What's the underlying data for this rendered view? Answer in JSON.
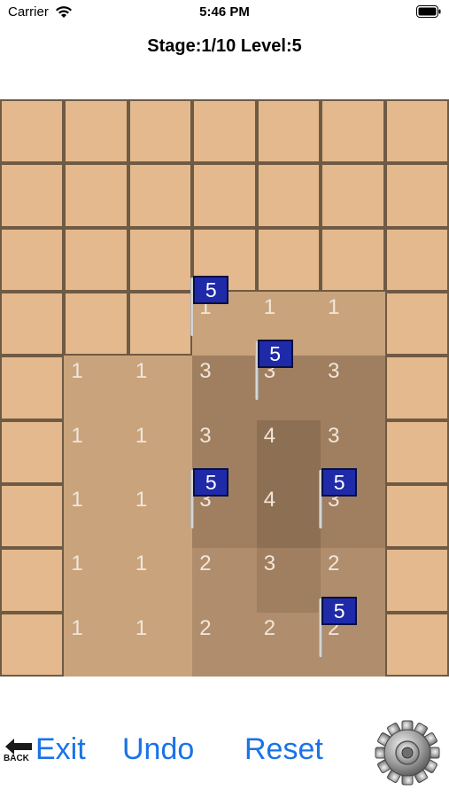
{
  "status": {
    "carrier": "Carrier",
    "time": "5:46 PM"
  },
  "header": {
    "title": "Stage:1/10 Level:5"
  },
  "board": {
    "cols": 7,
    "rows": 9,
    "cells": [
      [
        "raised",
        "raised",
        "raised",
        "raised",
        "raised",
        "raised",
        "raised"
      ],
      [
        "raised",
        "raised",
        "raised",
        "raised",
        "raised",
        "raised",
        "raised"
      ],
      [
        "raised",
        "raised",
        "raised",
        "raised",
        "raised",
        "raised",
        "raised"
      ],
      [
        "raised",
        "raised",
        "raised",
        "1",
        "1",
        "1",
        "raised"
      ],
      [
        "raised",
        "1",
        "1",
        "3",
        "3",
        "3",
        "raised"
      ],
      [
        "raised",
        "1",
        "1",
        "3",
        "4",
        "3",
        "raised"
      ],
      [
        "raised",
        "1",
        "1",
        "3",
        "4",
        "3",
        "raised"
      ],
      [
        "raised",
        "1",
        "1",
        "2",
        "3",
        "2",
        "raised"
      ],
      [
        "raised",
        "1",
        "1",
        "2",
        "2",
        "2",
        "raised"
      ]
    ],
    "flags": [
      {
        "row": 2,
        "col": 2,
        "label": "5"
      },
      {
        "row": 3,
        "col": 3,
        "label": "5"
      },
      {
        "row": 5,
        "col": 2,
        "label": "5"
      },
      {
        "row": 5,
        "col": 4,
        "label": "5"
      },
      {
        "row": 7,
        "col": 4,
        "label": "5"
      }
    ]
  },
  "controls": {
    "back_text": "BACK",
    "exit_label": "Exit",
    "undo_label": "Undo",
    "reset_label": "Reset"
  },
  "colors": {
    "raised": "#e3b98d",
    "level1": "#c9a37c",
    "level2": "#b08d6c",
    "level3": "#9f7f60",
    "level4": "#8d6f53",
    "button_blue": "#1a73e8",
    "flag_blue": "#1f2aa8"
  },
  "icons": [
    "wifi-icon",
    "battery-icon",
    "back-arrow-icon",
    "gear-icon",
    "flag-icon"
  ]
}
